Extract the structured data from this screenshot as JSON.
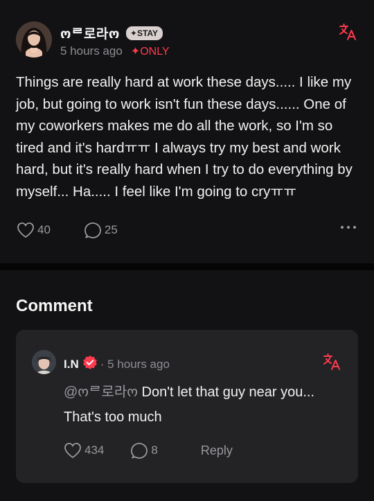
{
  "post": {
    "author": "ოᄅ로라ო",
    "badge": "✦STAY",
    "time": "5 hours ago",
    "visibility": "✦ONLY",
    "body": "Things are really hard at work these days..... I like my job, but going to work isn't fun these days...... One of my coworkers makes me do all the work, so I'm so tired and it's hardㅠㅠ I always try my best and work hard, but it's really hard when I try to do everything by myself... Ha..... I feel like I'm going to cryㅠㅠ",
    "likes": "40",
    "comments": "25",
    "icons": {
      "translate": "translate-icon",
      "like": "heart-icon",
      "comment": "comment-bubble-icon",
      "more": "more-dots-icon"
    }
  },
  "comments_section": {
    "heading": "Comment",
    "items": [
      {
        "author": "I.N",
        "time": "· 5 hours ago",
        "mention": "@ოᄅ로라ო",
        "text": " Don't let that guy near you... That's too much",
        "likes": "434",
        "replies": "8",
        "reply_label": "Reply"
      }
    ]
  },
  "colors": {
    "background": "#121214",
    "card": "#232326",
    "accent_red": "#ff3b4e",
    "muted": "#8e8e93"
  }
}
